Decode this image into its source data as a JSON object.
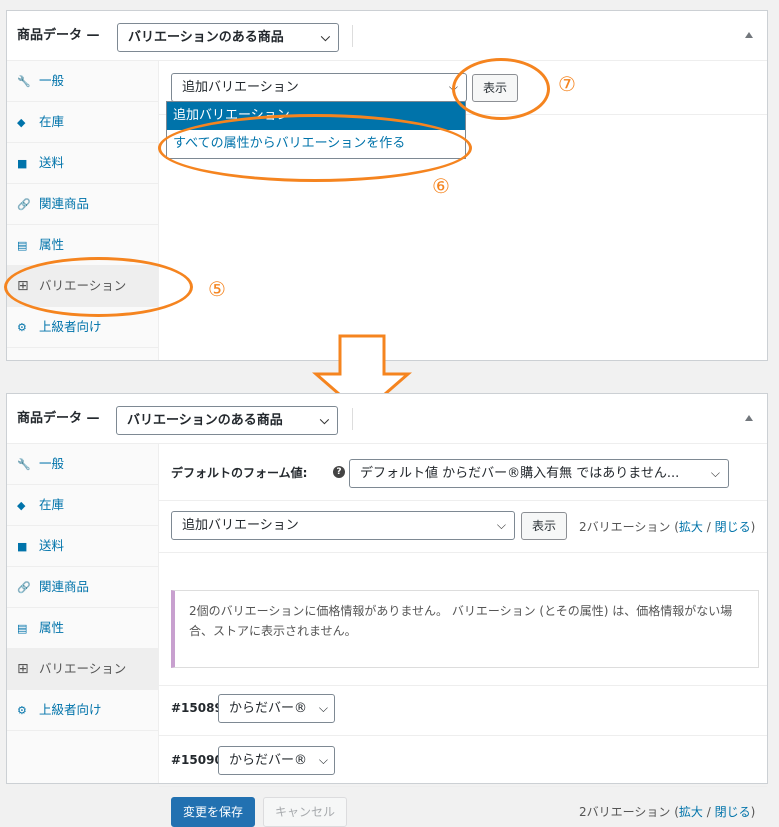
{
  "header": {
    "title": "商品データ —",
    "product_type": "バリエーションのある商品"
  },
  "sidebar": {
    "items": [
      {
        "label": "一般",
        "icon": "wrench-icon"
      },
      {
        "label": "在庫",
        "icon": "tag-icon"
      },
      {
        "label": "送料",
        "icon": "truck-icon"
      },
      {
        "label": "関連商品",
        "icon": "link-icon"
      },
      {
        "label": "属性",
        "icon": "table-icon"
      },
      {
        "label": "バリエーション",
        "icon": "grid-icon"
      },
      {
        "label": "上級者向け",
        "icon": "gear-icon"
      }
    ]
  },
  "top": {
    "variation_select": "追加バリエーション",
    "show_button": "表示",
    "dropdown_options": [
      "追加バリエーション",
      "すべての属性からバリエーションを作る"
    ],
    "annotations": [
      "⑤",
      "⑥",
      "⑦"
    ]
  },
  "bottom": {
    "default_form_label": "デフォルトのフォーム値:",
    "default_form_value": "デフォルト値 からだバー®購入有無 ではありません...",
    "variation_select": "追加バリエーション",
    "show_button": "表示",
    "counter_text": "2バリエーション (",
    "expand": "拡大",
    "slash": " / ",
    "close": "閉じる",
    "counter_end": ")",
    "notice": "2個のバリエーションに価格情報がありません。 バリエーション (とその属性) は、価格情報がない場合、ストアに表示されません。",
    "variations": [
      {
        "id": "#15089",
        "value": "からだバー®"
      },
      {
        "id": "#15090",
        "value": "からだバー®"
      }
    ],
    "save_button": "変更を保存",
    "cancel_button": "キャンセル"
  },
  "colors": {
    "annotation": "#f5841f",
    "link": "#0073aa",
    "primary": "#2271b1"
  }
}
